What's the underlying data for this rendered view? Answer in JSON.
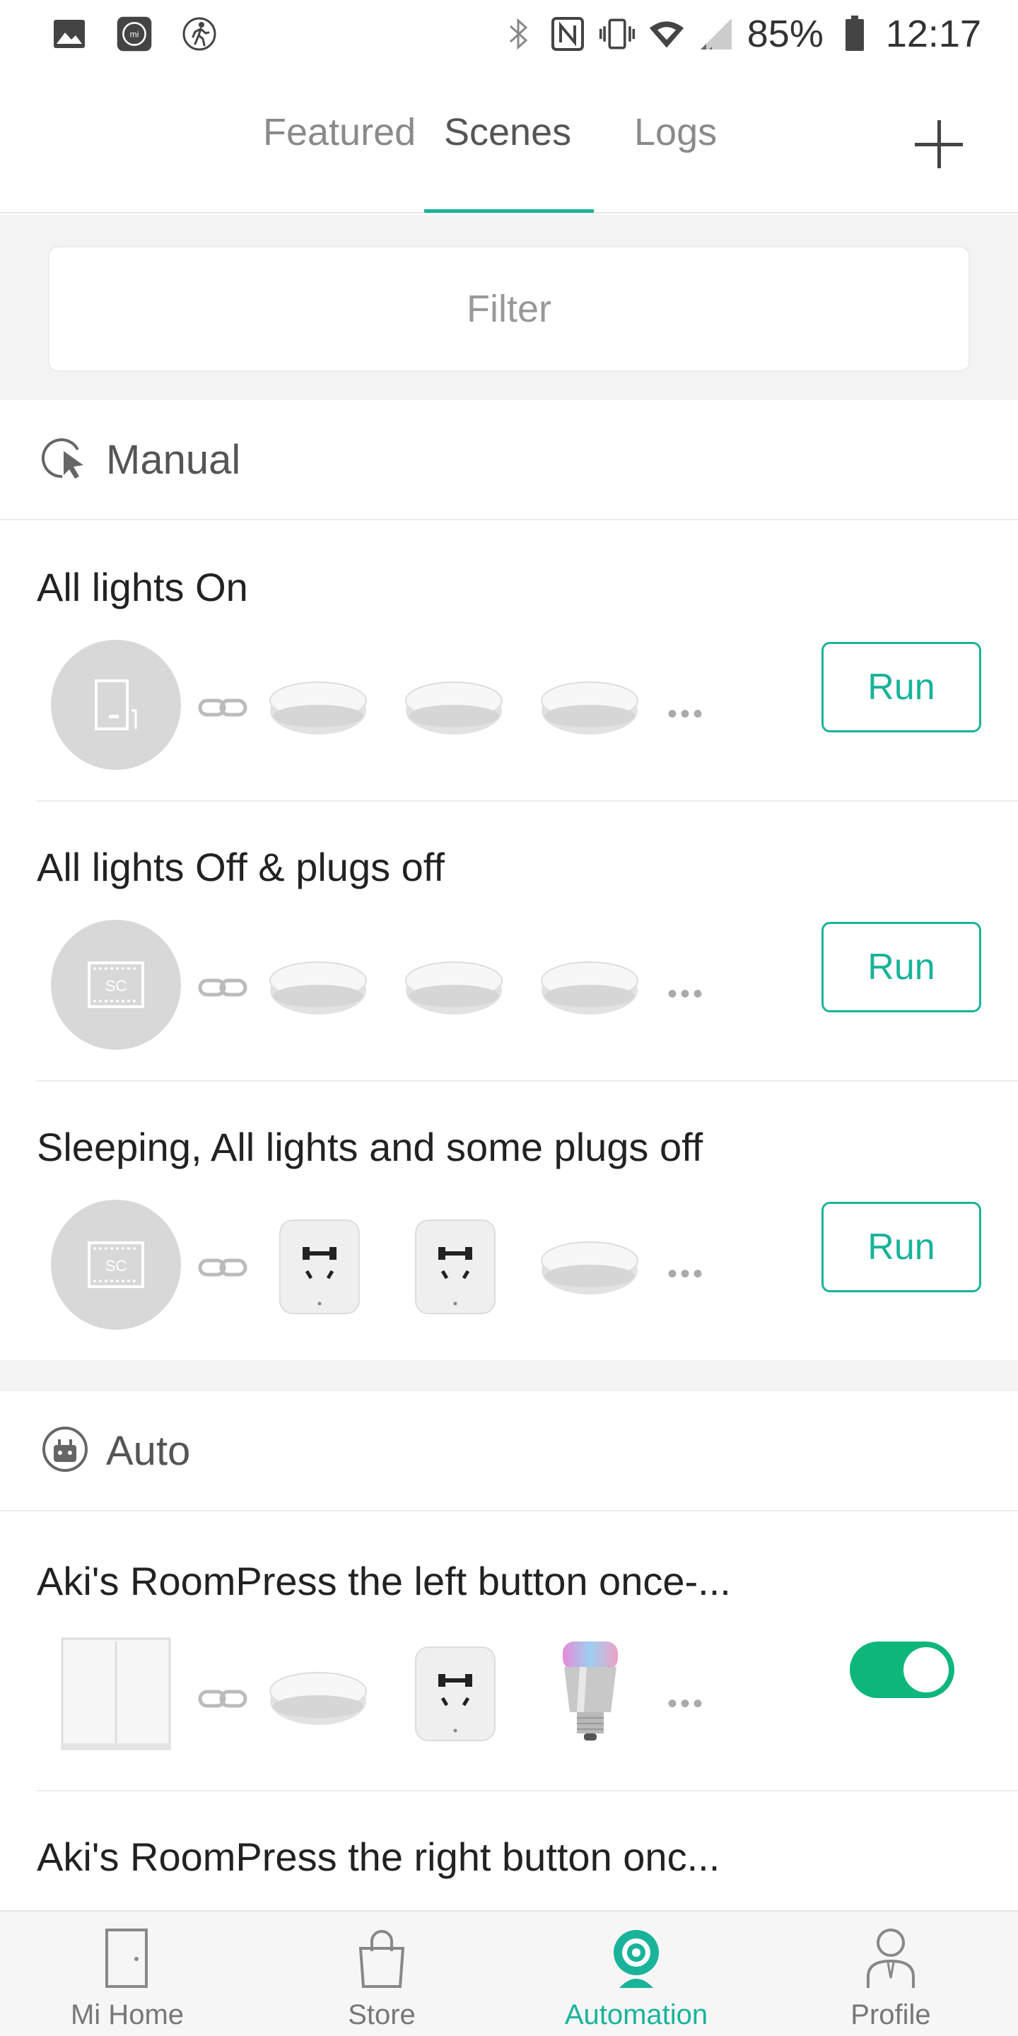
{
  "status_bar": {
    "battery": "85%",
    "time": "12:17",
    "left_icons": [
      "gallery-icon",
      "mi-icon",
      "fitness-icon"
    ],
    "right_icons": [
      "bluetooth-icon",
      "nfc-icon",
      "vibrate-icon",
      "wifi-icon",
      "signal-icon",
      "battery-icon"
    ]
  },
  "tabs": {
    "featured": "Featured",
    "scenes": "Scenes",
    "logs": "Logs",
    "active": "Scenes"
  },
  "filter": {
    "placeholder": "Filter"
  },
  "sections": {
    "manual": "Manual",
    "auto": "Auto"
  },
  "manual_scenes": [
    {
      "name": "All lights On",
      "run_label": "Run",
      "trigger": "door-icon",
      "devices": [
        "ceiling-light",
        "ceiling-light",
        "ceiling-light"
      ]
    },
    {
      "name": "All lights Off & plugs off",
      "run_label": "Run",
      "trigger": "scene-icon",
      "devices": [
        "ceiling-light",
        "ceiling-light",
        "ceiling-light"
      ]
    },
    {
      "name": "Sleeping, All lights and some plugs off",
      "run_label": "Run",
      "trigger": "scene-icon",
      "devices": [
        "smart-plug",
        "smart-plug",
        "ceiling-light"
      ]
    }
  ],
  "auto_scenes": [
    {
      "name": "Aki's RoomPress the left button once-...",
      "enabled": true,
      "devices": [
        "wall-switch",
        "ceiling-light",
        "smart-plug",
        "color-bulb"
      ]
    },
    {
      "name": "Aki's RoomPress the right button onc..."
    }
  ],
  "more_glyph": "•••",
  "bottom_nav": {
    "mi_home": "Mi Home",
    "store": "Store",
    "automation": "Automation",
    "profile": "Profile",
    "active": "Automation"
  },
  "colors": {
    "accent": "#19b39a",
    "toggle_on": "#0db67a",
    "background_band": "#f3f3f3"
  }
}
